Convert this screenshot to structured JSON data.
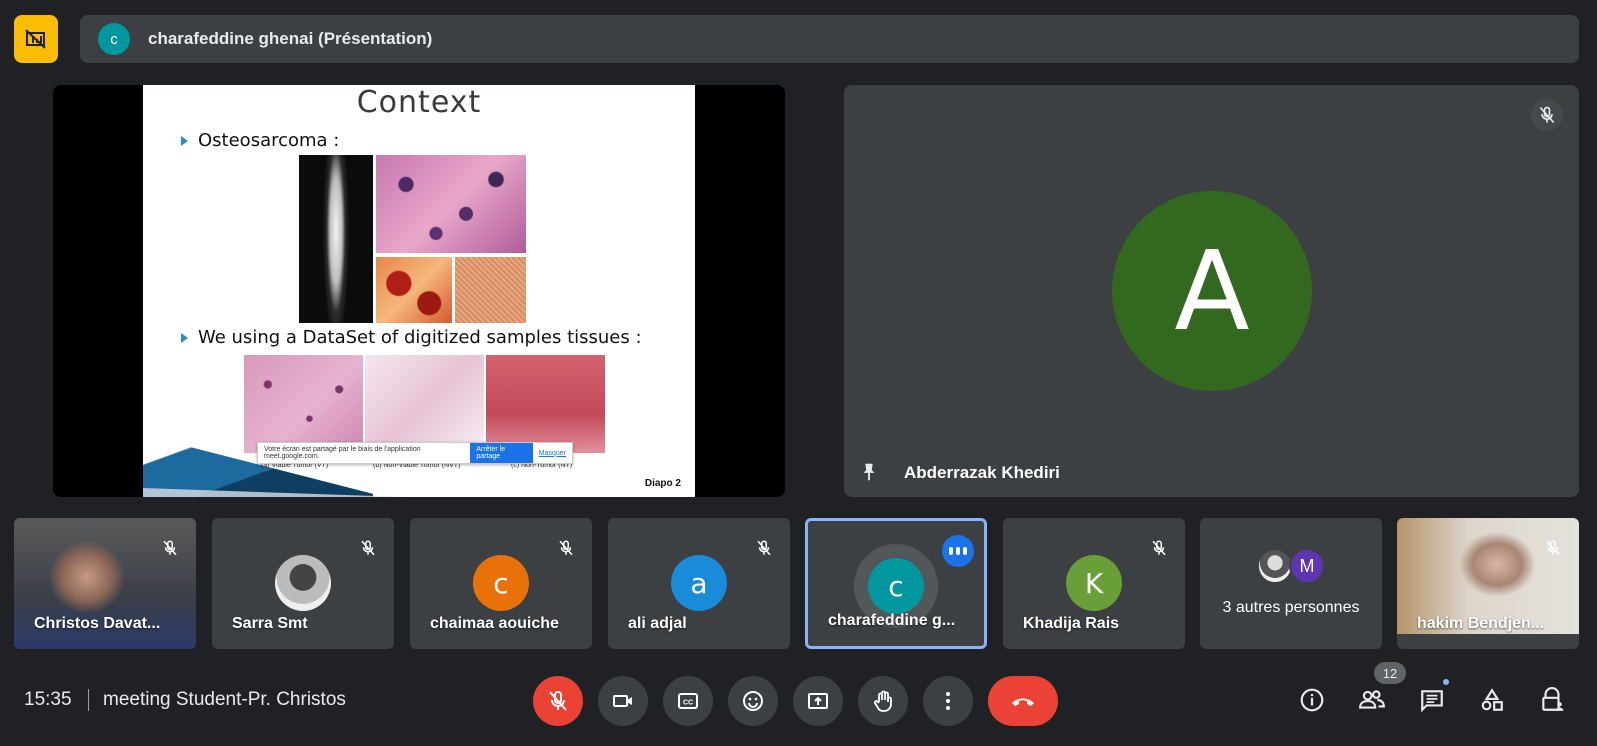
{
  "presenting_bar": {
    "avatar_letter": "c",
    "title": "charafeddine ghenai (Présentation)"
  },
  "slide": {
    "title": "Context",
    "bullet1": "Osteosarcoma :",
    "bullet2": "We using a DataSet of digitized samples tissues :",
    "share_notice": "Votre écran est partagé par le biais de l'application meet.google.com.",
    "stop_share": "Arrêter le partage",
    "hide": "Masquer",
    "caption_a": "(a) Viable Tumor (VT)",
    "caption_b": "(b) Non-Viable Tumor (NVT)",
    "caption_c": "(c) Non-Tumor (NT)",
    "slide_number": "Diapo 2"
  },
  "pinned": {
    "avatar_letter": "A",
    "name": "Abderrazak Khediri",
    "avatar_color": "#33691e"
  },
  "participants": [
    {
      "name": "Christos Davat...",
      "type": "video"
    },
    {
      "name": "Sarra Smt",
      "type": "photo"
    },
    {
      "name": "chaimaa aouiche",
      "letter": "c",
      "color": "#e8710a"
    },
    {
      "name": "ali adjal",
      "letter": "a",
      "color": "#1a8bd8"
    },
    {
      "name": "charafeddine g...",
      "letter": "c",
      "color": "#00979e",
      "speaking": true
    },
    {
      "name": "Khadija Rais",
      "letter": "K",
      "color": "#689f38"
    },
    {
      "name": "3 autres personnes",
      "letter": "M",
      "color": "#5e35b1"
    },
    {
      "name": "hakim Bendjen...",
      "type": "video"
    }
  ],
  "bottom_bar": {
    "time": "15:35",
    "meeting_title": "meeting Student-Pr. Christos",
    "participant_count": "12"
  },
  "colors": {
    "background": "#202124",
    "tile": "#3c4043",
    "end_call": "#ea4335",
    "presenting": "#fbbc04",
    "active_border": "#8ab4f8"
  }
}
